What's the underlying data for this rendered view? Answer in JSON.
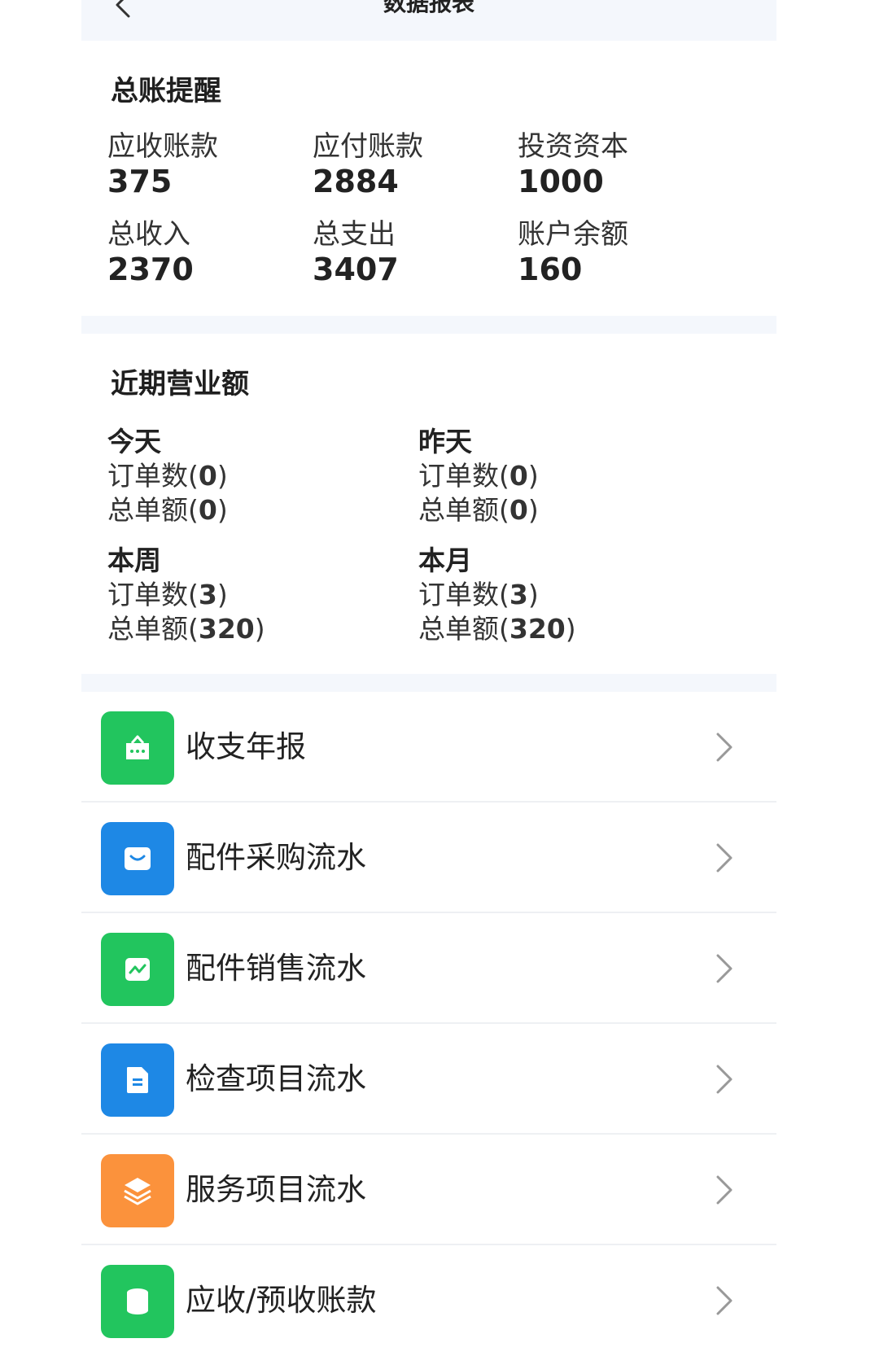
{
  "header": {
    "title": "数据报表"
  },
  "ledger": {
    "title": "总账提醒",
    "items": [
      {
        "label": "应收账款",
        "value": "375"
      },
      {
        "label": "应付账款",
        "value": "2884"
      },
      {
        "label": "投资资本",
        "value": "1000"
      },
      {
        "label": "总收入",
        "value": "2370"
      },
      {
        "label": "总支出",
        "value": "3407"
      },
      {
        "label": "账户余额",
        "value": "160"
      }
    ]
  },
  "revenue": {
    "title": "近期营业额",
    "order_label": "订单数",
    "amount_label": "总单额",
    "periods": [
      {
        "name": "今天",
        "orders": "0",
        "amount": "0"
      },
      {
        "name": "昨天",
        "orders": "0",
        "amount": "0"
      },
      {
        "name": "本周",
        "orders": "3",
        "amount": "320"
      },
      {
        "name": "本月",
        "orders": "3",
        "amount": "320"
      }
    ]
  },
  "menu": [
    {
      "label": "收支年报",
      "icon": "shopping-bag-icon",
      "color": "#22c55e"
    },
    {
      "label": "配件采购流水",
      "icon": "envelope-icon",
      "color": "#1e88e5"
    },
    {
      "label": "配件销售流水",
      "icon": "trend-chart-icon",
      "color": "#22c55e"
    },
    {
      "label": "检查项目流水",
      "icon": "document-icon",
      "color": "#1e88e5"
    },
    {
      "label": "服务项目流水",
      "icon": "layers-icon",
      "color": "#fb923c"
    },
    {
      "label": "应收/预收账款",
      "icon": "database-icon",
      "color": "#22c55e"
    }
  ]
}
